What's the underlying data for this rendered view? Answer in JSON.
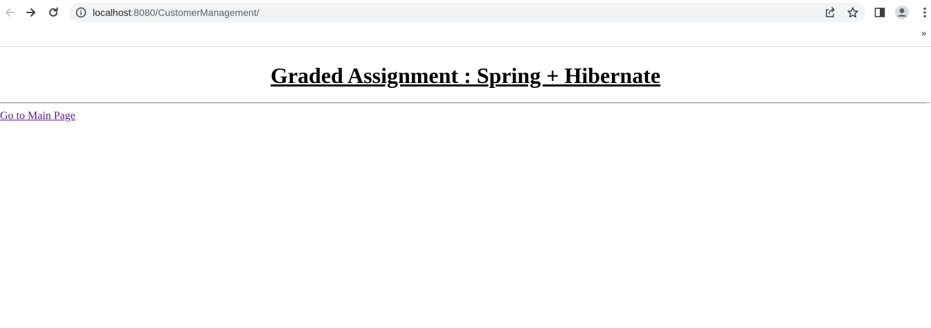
{
  "browser": {
    "url_host": "localhost",
    "url_path": ":8080/CustomerManagement/",
    "icons": {
      "back": "arrow-left-icon",
      "forward": "arrow-right-icon",
      "reload": "reload-icon",
      "info": "info-icon",
      "share": "share-icon",
      "bookmark": "star-icon",
      "side_panel": "side-panel-icon",
      "profile": "profile-icon",
      "menu": "kebab-menu-icon"
    },
    "bookmarks_overflow": "»"
  },
  "page": {
    "heading": "Graded Assignment : Spring + Hibernate",
    "link_text": "Go to Main Page"
  }
}
